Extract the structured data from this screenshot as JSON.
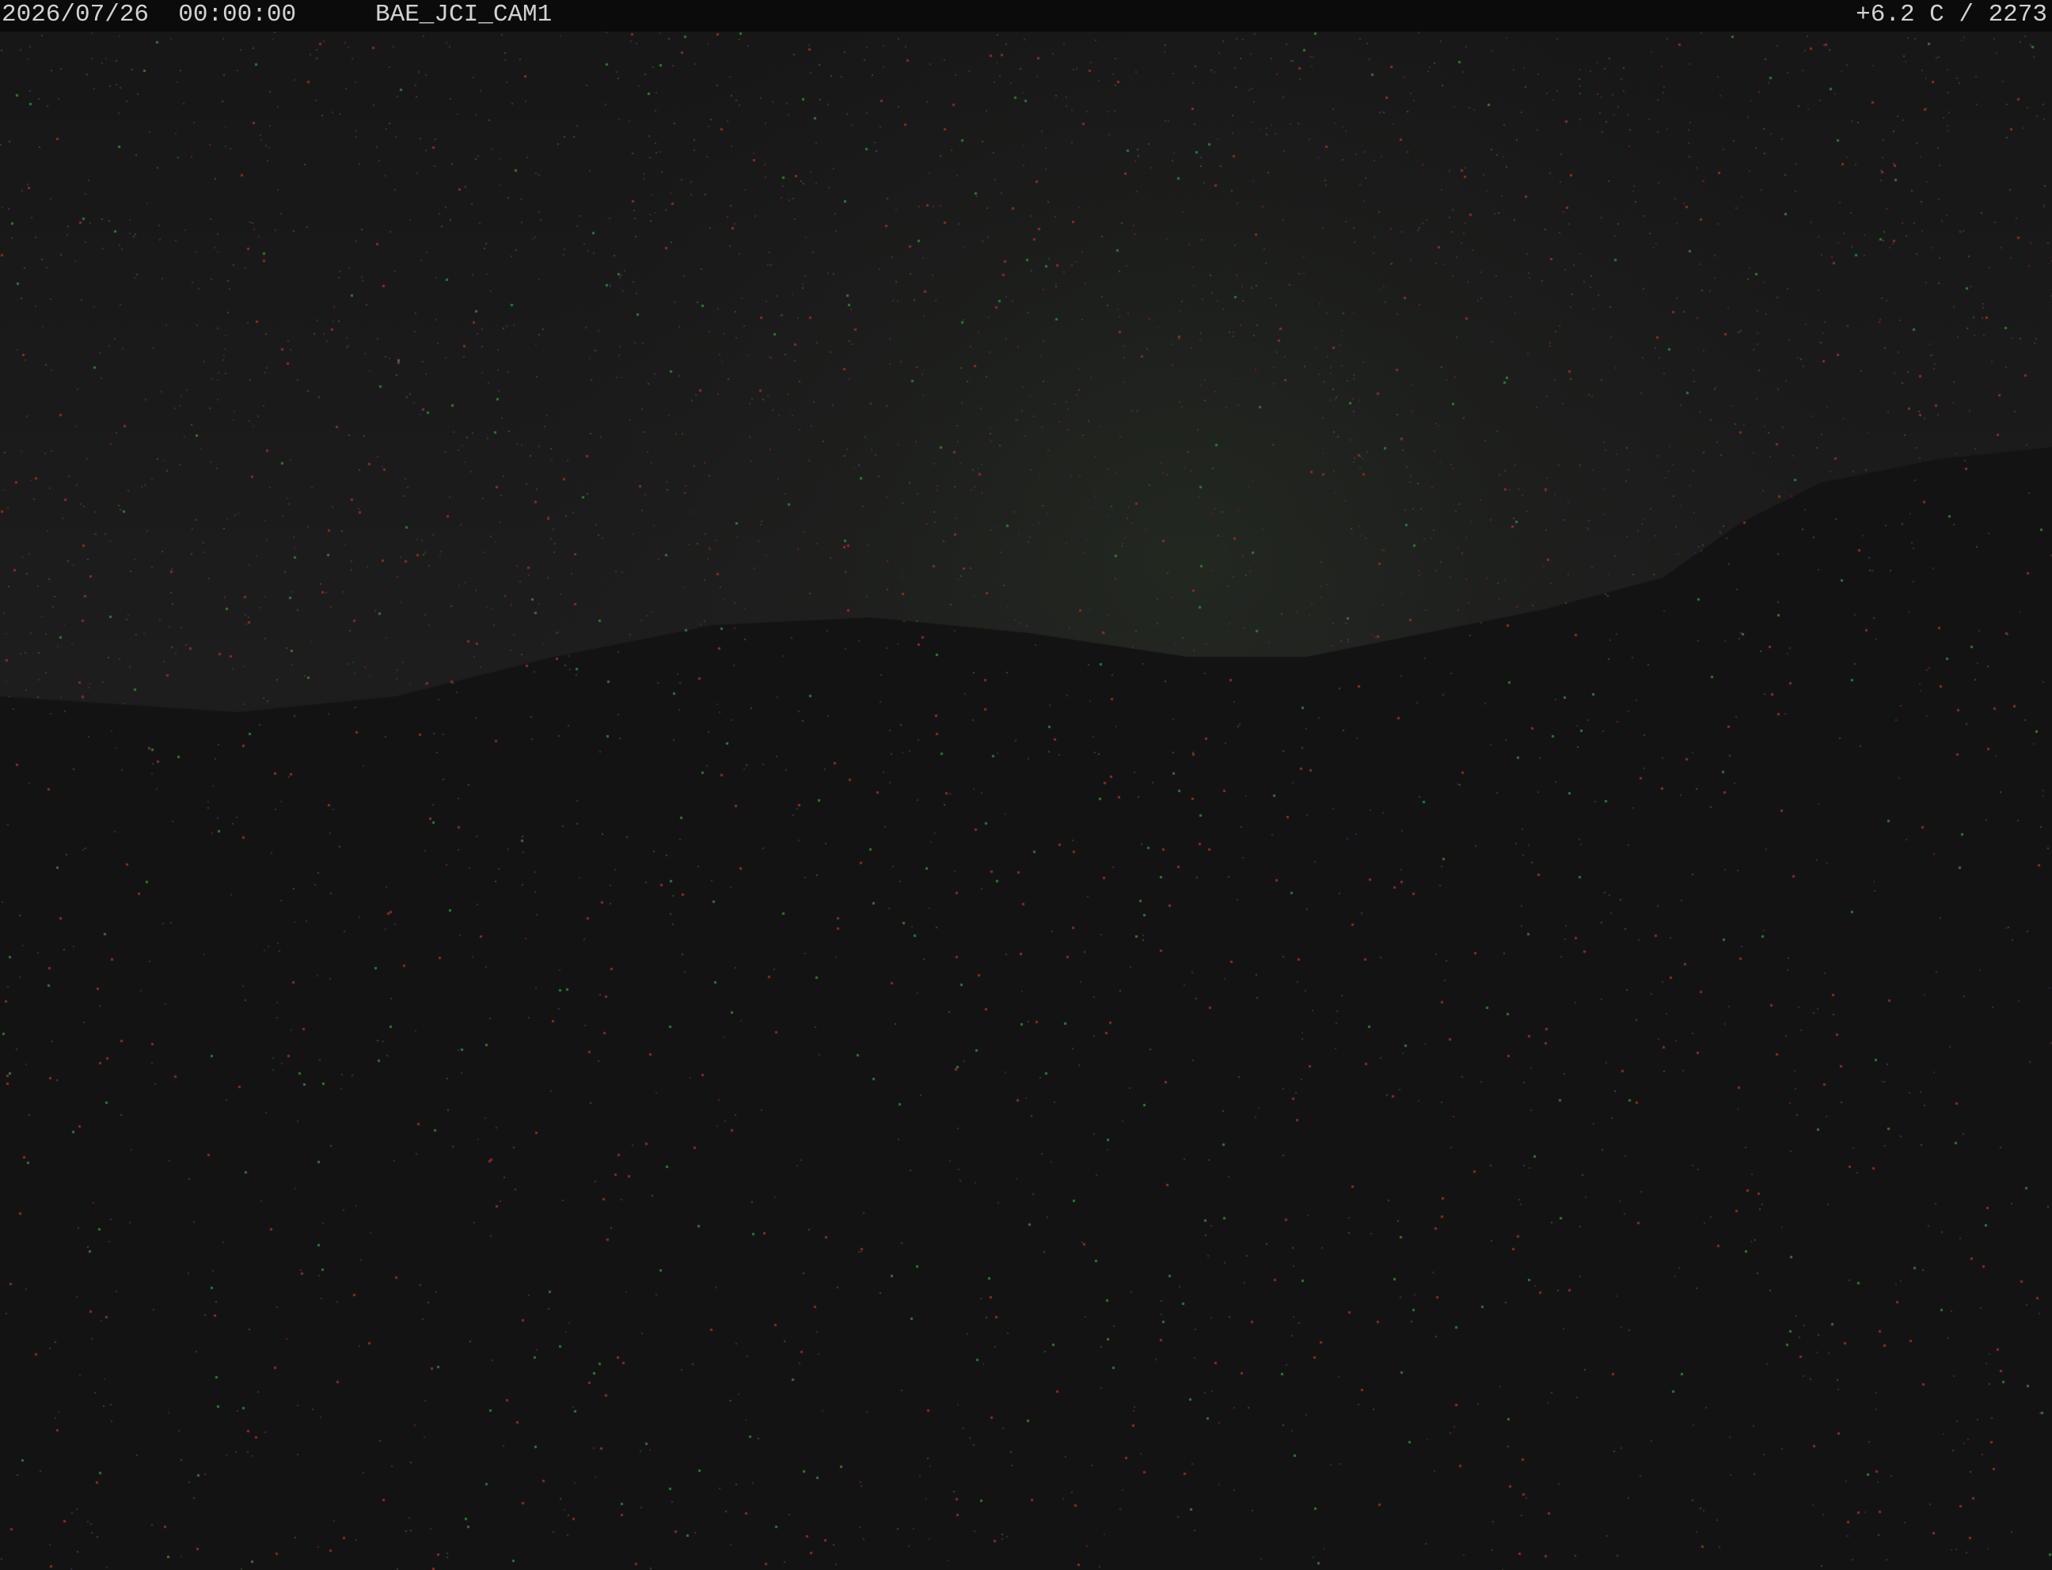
{
  "osd": {
    "datetime": "2026/07/26  00:00:00",
    "camera_id": "BAE_JCI_CAM1",
    "sensor_readout": "+6.2 C / 2273"
  },
  "scene": {
    "description_icon": "night-mountain-webcam-image",
    "colors": {
      "sky": "#1d1d1d",
      "ground": "#131313",
      "osd_background": "#0b0b0b",
      "osd_text": "#d2d2d2"
    }
  }
}
